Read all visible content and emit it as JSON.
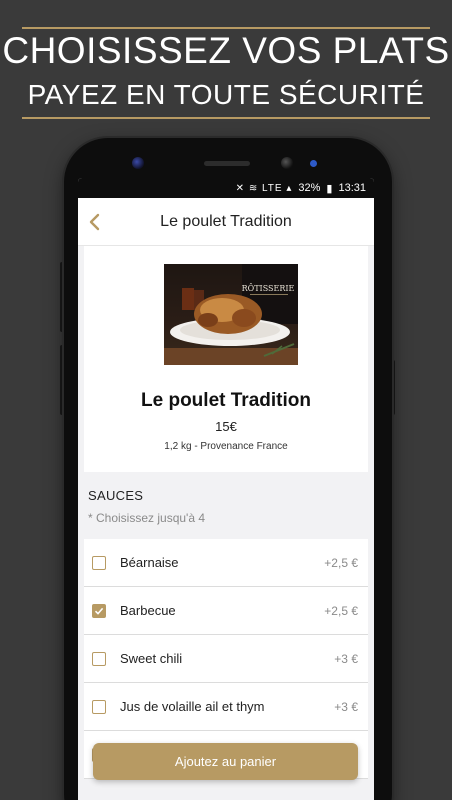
{
  "banner": {
    "line1": "CHOISISSEZ VOS PLATS",
    "line2": "PAYEZ EN TOUTE SÉCURITÉ"
  },
  "status": {
    "icons": "✕ ≋ LTE ▴",
    "battery": "32%",
    "time": "13:31"
  },
  "app": {
    "title": "Le poulet Tradition"
  },
  "product": {
    "name": "Le poulet Tradition",
    "price": "15€",
    "meta": "1,2 kg - Provenance France",
    "image_sign": "RÔTISSERIE"
  },
  "sauces": {
    "title": "SAUCES",
    "subtitle": "* Choisissez jusqu'à 4",
    "items": [
      {
        "label": "Béarnaise",
        "price": "+2,5 €",
        "checked": false
      },
      {
        "label": "Barbecue",
        "price": "+2,5 €",
        "checked": true
      },
      {
        "label": "Sweet chili",
        "price": "+3 €",
        "checked": false
      },
      {
        "label": "Jus de volaille ail et thym",
        "price": "+3 €",
        "checked": false
      },
      {
        "label": "",
        "price": "€",
        "checked": false
      }
    ]
  },
  "cta": {
    "label": "Ajoutez au panier"
  },
  "colors": {
    "accent": "#b79a63",
    "background": "#3a3a3a"
  }
}
